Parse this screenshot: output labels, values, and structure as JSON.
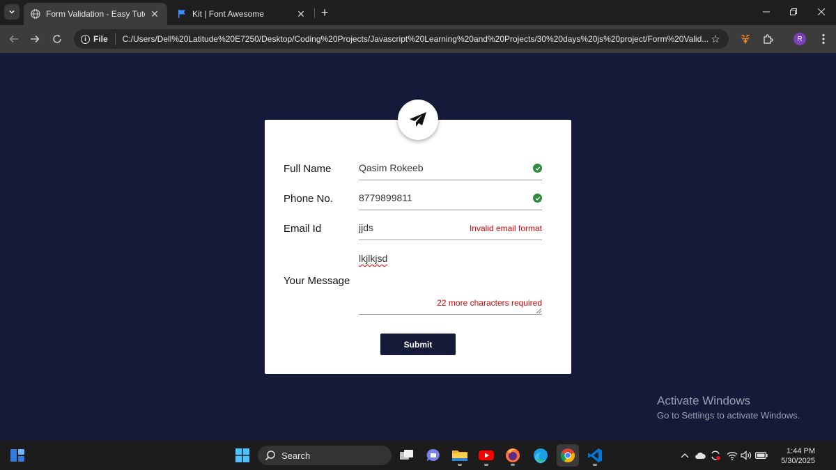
{
  "browser": {
    "tabs": [
      {
        "title": "Form Validation - Easy Tutorials",
        "active": true
      },
      {
        "title": "Kit | Font Awesome",
        "active": false
      }
    ],
    "address": {
      "scheme_label": "File",
      "url": "C:/Users/Dell%20Latitude%20E7250/Desktop/Coding%20Projects/Javascript%20Learning%20and%20Projects/30%20days%20js%20project/Form%20Valid..."
    },
    "profile_initial": "R"
  },
  "form": {
    "rows": [
      {
        "label": "Full Name",
        "value": "Qasim Rokeeb",
        "status": "valid",
        "message": ""
      },
      {
        "label": "Phone No.",
        "value": "8779899811",
        "status": "valid",
        "message": ""
      },
      {
        "label": "Email Id",
        "value": "jjds",
        "status": "error",
        "message": "Invalid email format"
      }
    ],
    "message_row": {
      "label": "Your Message",
      "value": "lkjlkjsd",
      "message": "22 more characters required"
    },
    "submit_label": "Submit"
  },
  "watermark": {
    "title": "Activate Windows",
    "subtitle": "Go to Settings to activate Windows."
  },
  "taskbar": {
    "search_label": "Search",
    "time": "1:44 PM",
    "date": "5/30/2025"
  },
  "colors": {
    "page_bg": "#141a38",
    "valid": "#2e8b3a",
    "error": "#d40000",
    "button_bg": "#141a38"
  }
}
